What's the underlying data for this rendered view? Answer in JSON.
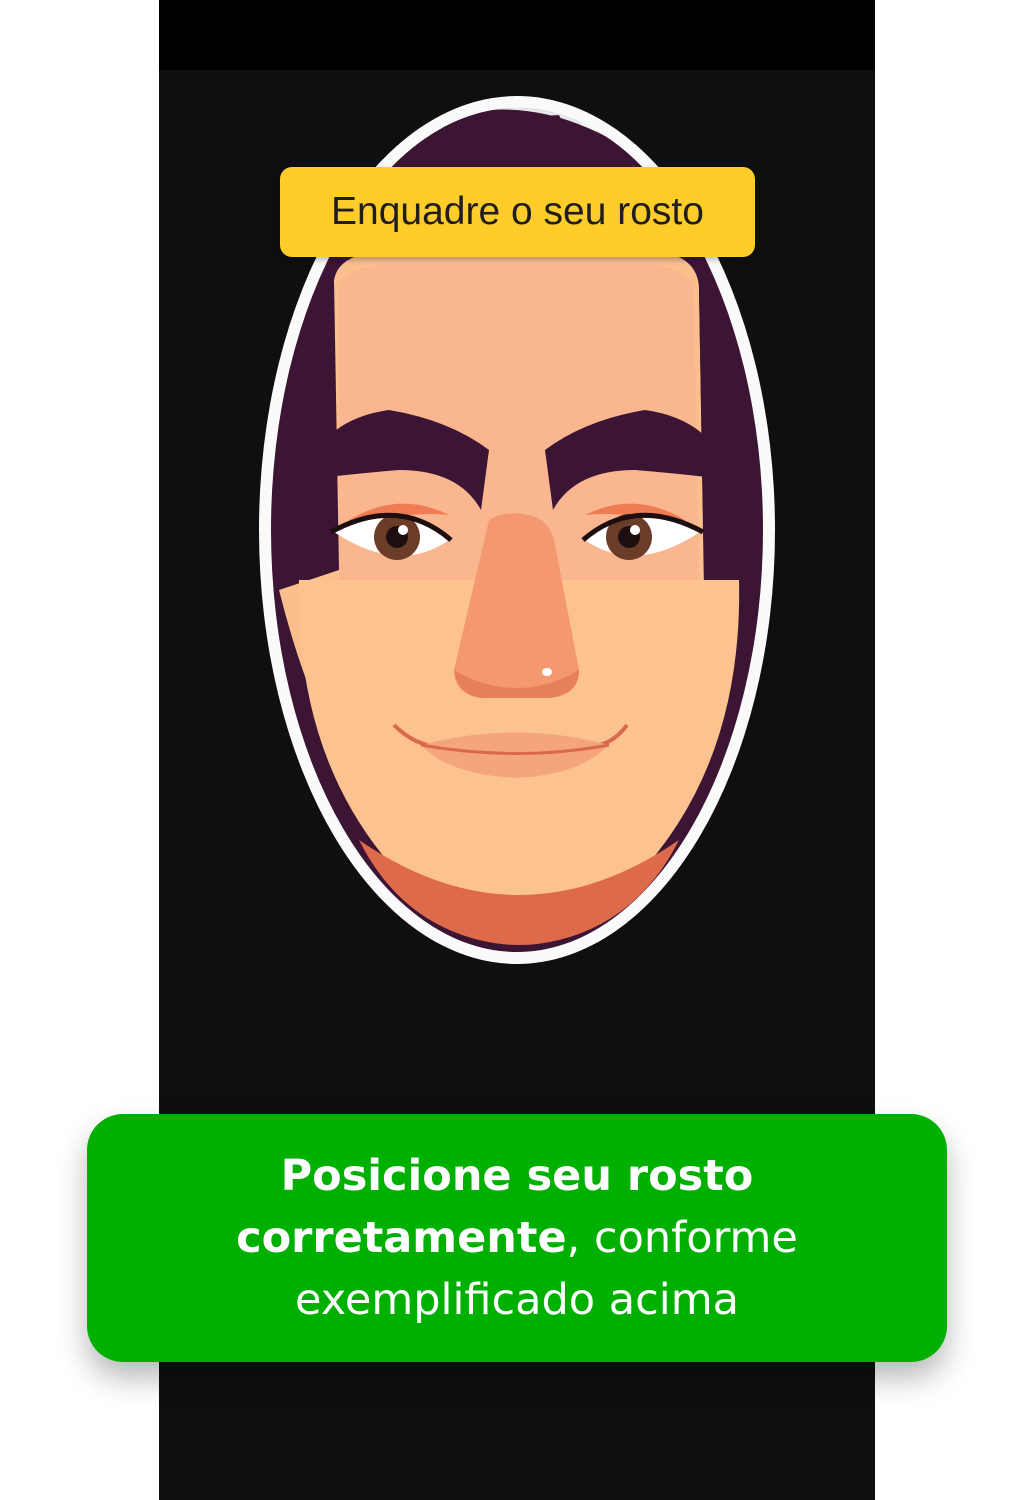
{
  "camera": {
    "frame_label": "Enquadre o seu rosto"
  },
  "instruction": {
    "bold_text": "Posicione seu rosto corretamente",
    "normal_text": ", conforme exemplificado acima"
  },
  "colors": {
    "background": "#ffffff",
    "camera_background": "#0f0f0f",
    "status_bar": "#000000",
    "label_background": "#ffcc29",
    "card_background": "#00b000",
    "oval_outline": "#ffffff",
    "skin": "#f9b98a",
    "hair": "#3b1533"
  },
  "icons": {
    "face": "face-illustration"
  }
}
